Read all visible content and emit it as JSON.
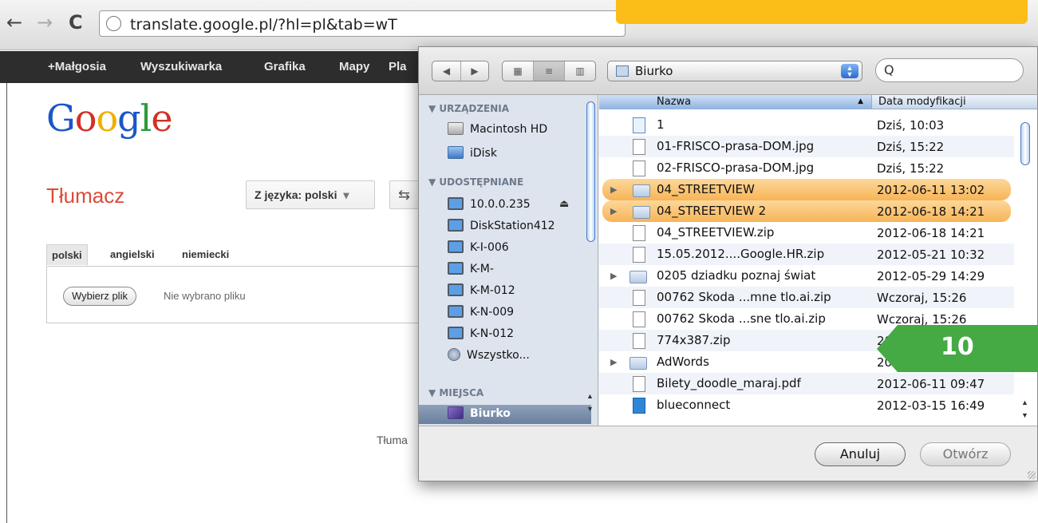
{
  "browser": {
    "url": "translate.google.pl/?hl=pl&tab=wT",
    "back_glyph": "←",
    "forward_glyph": "→",
    "reload_glyph": "C"
  },
  "gbar": {
    "items": [
      "+Małgosia",
      "Wyszukiwarka",
      "Grafika",
      "Mapy",
      "Pla"
    ]
  },
  "google": {
    "logo": [
      "G",
      "o",
      "o",
      "g",
      "l",
      "e"
    ],
    "title": "Tłumacz",
    "source_lang": "Z języka: polski",
    "source_lang_arrow": "▾",
    "swap_glyph": "⇆",
    "lang_tabs": [
      "polski",
      "angielski",
      "niemiecki"
    ],
    "file_button": "Wybierz plik",
    "file_status": "Nie wybrano pliku",
    "footer": "Tłuma"
  },
  "dialog": {
    "back_glyph": "◀",
    "forward_glyph": "▶",
    "view_icons": "▦",
    "view_list": "≡",
    "view_columns": "▥",
    "folder": "Biurko",
    "folder_stepper": "▲▼",
    "search_glyph": "Q",
    "sidebar": {
      "sections": [
        "URZĄDZENIA",
        "UDOSTĘPNIANE",
        "MIEJSCA"
      ],
      "devices": [
        "Macintosh HD",
        "iDisk"
      ],
      "shared": [
        "10.0.0.235",
        "DiskStation412",
        "K-I-006",
        "K-M-",
        "K-M-012",
        "K-N-009",
        "K-N-012",
        "Wszystko..."
      ],
      "places": [
        "Biurko"
      ],
      "eject_glyph": "⏏"
    },
    "columns": {
      "name": "Nazwa",
      "date": "Data modyfikacji",
      "sort_glyph": "▲"
    },
    "files": [
      {
        "name": "1",
        "date": "Dziś, 10:03"
      },
      {
        "name": "01-FRISCO-prasa-DOM.jpg",
        "date": "Dziś, 15:22"
      },
      {
        "name": "02-FRISCO-prasa-DOM.jpg",
        "date": "Dziś, 15:22"
      },
      {
        "name": "04_STREETVIEW",
        "date": "2012-06-11 13:02"
      },
      {
        "name": "04_STREETVIEW 2",
        "date": "2012-06-18 14:21"
      },
      {
        "name": "04_STREETVIEW.zip",
        "date": "2012-06-18 14:21"
      },
      {
        "name": "15.05.2012....Google.HR.zip",
        "date": "2012-05-21 10:32"
      },
      {
        "name": "0205 dziadku poznaj świat",
        "date": "2012-05-29 14:29"
      },
      {
        "name": "00762 Skoda ...mne tlo.ai.zip",
        "date": "Wczoraj, 15:26"
      },
      {
        "name": "00762 Skoda ...sne tlo.ai.zip",
        "date": "Wczoraj, 15:26"
      },
      {
        "name": "774x387.zip",
        "date": "20"
      },
      {
        "name": "AdWords",
        "date": "201"
      },
      {
        "name": "Bilety_doodle_maraj.pdf",
        "date": "2012-06-11 09:47"
      },
      {
        "name": "blueconnect",
        "date": "2012-03-15 16:49"
      }
    ],
    "tree_glyph": "▶",
    "cancel": "Anuluj",
    "open": "Otwórz"
  },
  "badge": {
    "number": "10"
  },
  "colors": {
    "accent_yellow": "#fbbd18",
    "badge_green": "#45a944",
    "highlight_orange": "#f7b456"
  }
}
